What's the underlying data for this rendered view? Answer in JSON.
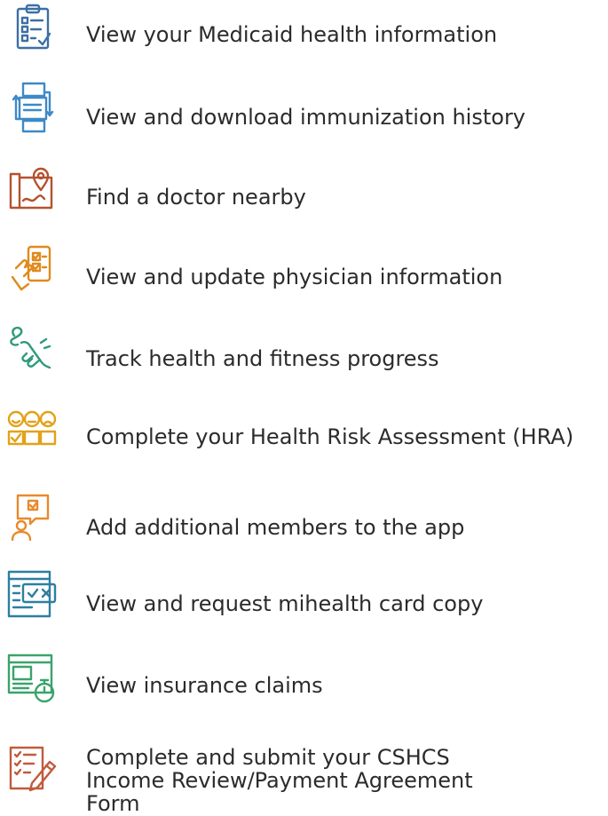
{
  "features": [
    {
      "icon": "clipboard-checklist-icon",
      "color": "#3c6fa4",
      "label": "View your Medicaid health information"
    },
    {
      "icon": "document-transfer-icon",
      "color": "#3e89c7",
      "label": "View and download immunization history"
    },
    {
      "icon": "map-pin-icon",
      "color": "#b4522e",
      "label": "Find a doctor nearby"
    },
    {
      "icon": "hand-phone-checklist-icon",
      "color": "#e08a1c",
      "label": "View and update physician information"
    },
    {
      "icon": "hand-swipe-icon",
      "color": "#2f9a7c",
      "label": "Track health and fitness progress"
    },
    {
      "icon": "face-rating-icon",
      "color": "#e2a21a",
      "label": "Complete your Health Risk Assessment (HRA)"
    },
    {
      "icon": "user-message-icon",
      "color": "#e88a2c",
      "label": "Add additional members to the app"
    },
    {
      "icon": "browser-card-icon",
      "color": "#2d7fa0",
      "label": "View and request mihealth card copy"
    },
    {
      "icon": "browser-stopwatch-icon",
      "color": "#3aa36b",
      "label": "View insurance claims"
    },
    {
      "icon": "form-pencil-icon",
      "color": "#c15a3d",
      "label": "Complete and submit your CSHCS Income Review/Payment Agreement Form"
    }
  ]
}
